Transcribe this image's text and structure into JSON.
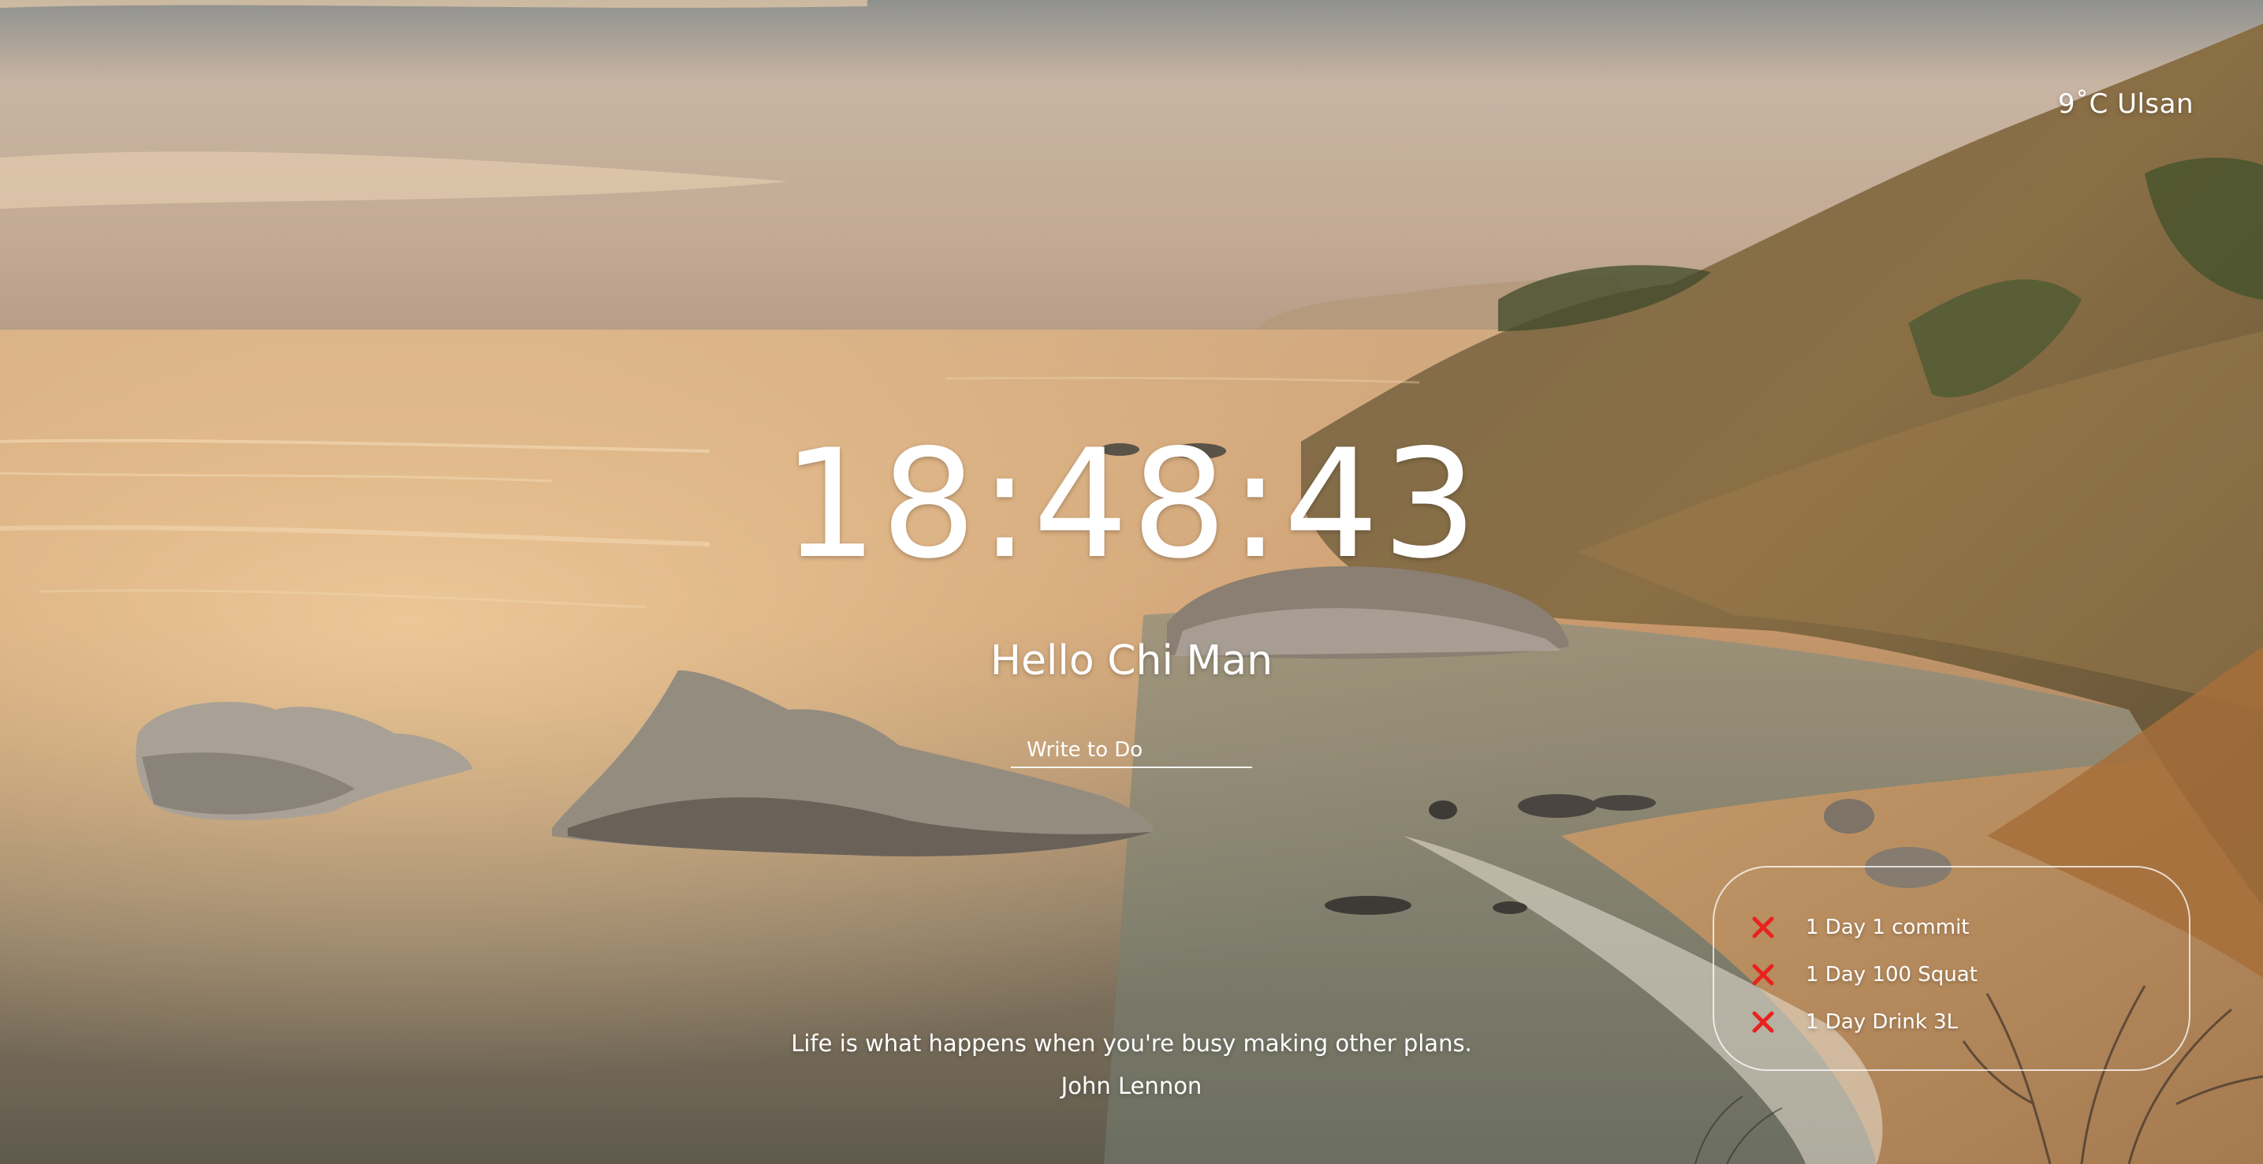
{
  "weather": {
    "temperature": "9˚C",
    "city": "Ulsan"
  },
  "clock": {
    "time": "18:48:43"
  },
  "greeting": {
    "text": "Hello Chi Man"
  },
  "todo": {
    "placeholder": "Write to Do",
    "value": "",
    "delete_icon": "close-icon",
    "delete_color": "#e8231e",
    "items": [
      {
        "label": "1 Day 1 commit"
      },
      {
        "label": "1 Day 100 Squat"
      },
      {
        "label": "1 Day Drink 3L"
      }
    ]
  },
  "quote": {
    "text": "Life is what happens when you're busy making other plans.",
    "author": "John Lennon"
  },
  "background": {
    "sky_color": "#b8a593",
    "sea_color": "#c59a6f",
    "accent_color": "#ffffff"
  }
}
